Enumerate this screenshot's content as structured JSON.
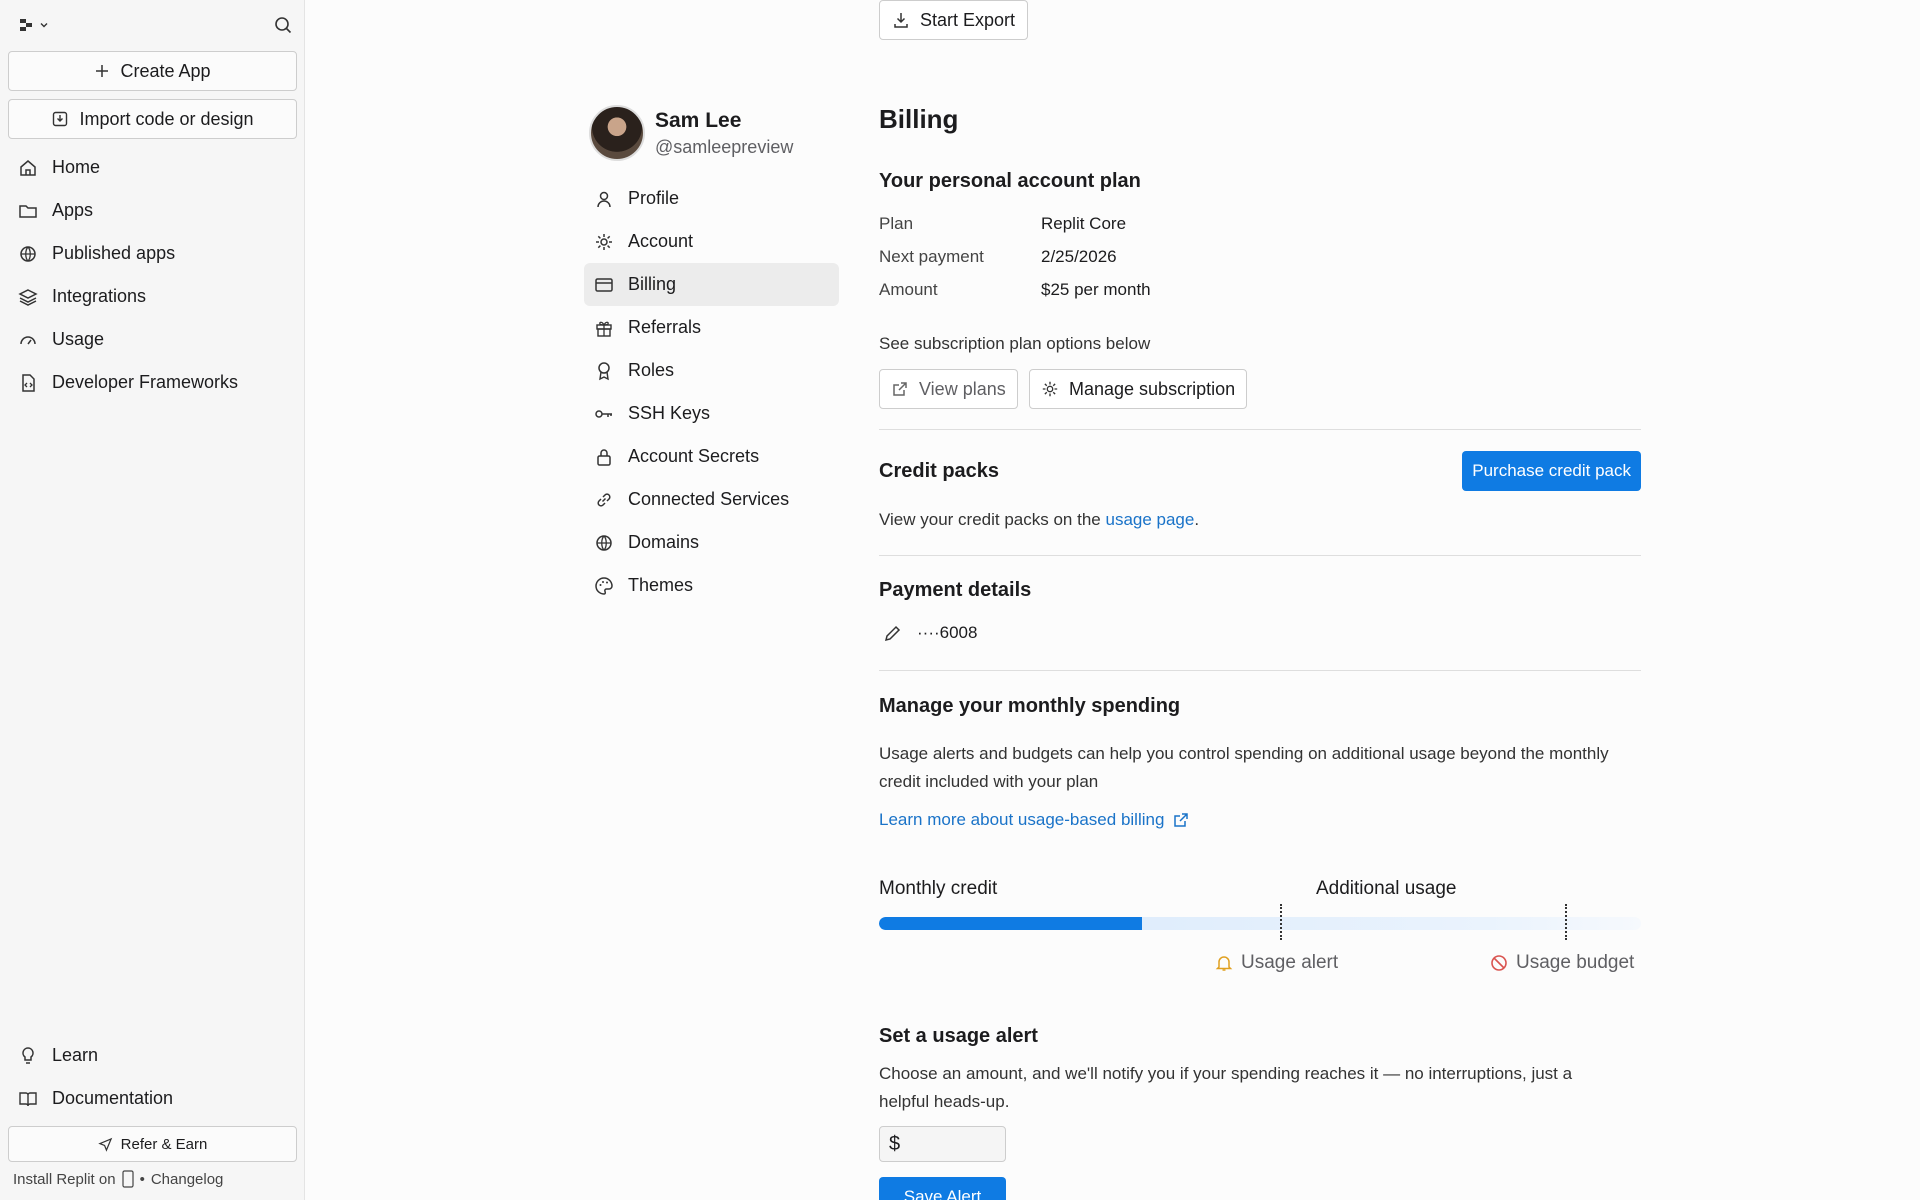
{
  "sidebar": {
    "create_app": "Create App",
    "import": "Import code or design",
    "items": [
      {
        "label": "Home",
        "icon": "home-icon"
      },
      {
        "label": "Apps",
        "icon": "folder-icon"
      },
      {
        "label": "Published apps",
        "icon": "globe-icon"
      },
      {
        "label": "Integrations",
        "icon": "layers-icon"
      },
      {
        "label": "Usage",
        "icon": "gauge-icon"
      },
      {
        "label": "Developer Frameworks",
        "icon": "file-code-icon"
      }
    ],
    "bottom_items": [
      {
        "label": "Learn",
        "icon": "lightbulb-icon"
      },
      {
        "label": "Documentation",
        "icon": "book-icon"
      }
    ],
    "refer": "Refer & Earn",
    "install": "Install Replit on",
    "separator": "•",
    "changelog": "Changelog"
  },
  "top": {
    "export": "Start Export"
  },
  "profile": {
    "name": "Sam Lee",
    "handle": "@samleepreview"
  },
  "settings_nav": [
    {
      "label": "Profile",
      "icon": "user-icon"
    },
    {
      "label": "Account",
      "icon": "gear-icon"
    },
    {
      "label": "Billing",
      "icon": "credit-card-icon",
      "active": true
    },
    {
      "label": "Referrals",
      "icon": "gift-icon"
    },
    {
      "label": "Roles",
      "icon": "badge-icon"
    },
    {
      "label": "SSH Keys",
      "icon": "key-icon"
    },
    {
      "label": "Account Secrets",
      "icon": "lock-icon"
    },
    {
      "label": "Connected Services",
      "icon": "link-icon"
    },
    {
      "label": "Domains",
      "icon": "globe-icon"
    },
    {
      "label": "Themes",
      "icon": "palette-icon"
    }
  ],
  "billing": {
    "title": "Billing",
    "plan_heading": "Your personal account plan",
    "plan_label": "Plan",
    "plan_value": "Replit Core",
    "next_label": "Next payment",
    "next_value": "2/25/2026",
    "amount_label": "Amount",
    "amount_value": "$25 per month",
    "see_options": "See subscription plan options below",
    "view_plans": "View plans",
    "manage_sub": "Manage subscription",
    "credit_heading": "Credit packs",
    "purchase": "Purchase credit pack",
    "credit_text_pre": "View your credit packs on the ",
    "credit_link": "usage page",
    "credit_text_post": ".",
    "payment_heading": "Payment details",
    "card": "····6008",
    "spending_heading": "Manage your monthly spending",
    "spending_text": "Usage alerts and budgets can help you control spending on additional usage beyond the monthly credit included with your plan",
    "learn_more": "Learn more about usage-based billing",
    "monthly_credit": "Monthly credit",
    "additional_usage": "Additional usage",
    "usage_progress": 0.345,
    "usage_alert": "Usage alert",
    "usage_budget": "Usage budget",
    "alert_heading": "Set a usage alert",
    "alert_text": "Choose an amount, and we'll notify you if your spending reaches it — no interruptions, just a helpful heads-up.",
    "currency": "$",
    "save_alert": "Save Alert"
  },
  "colors": {
    "accent": "#0f7be3",
    "link": "#1a73c8",
    "alert": "#e0a020",
    "budget": "#d9534f"
  }
}
